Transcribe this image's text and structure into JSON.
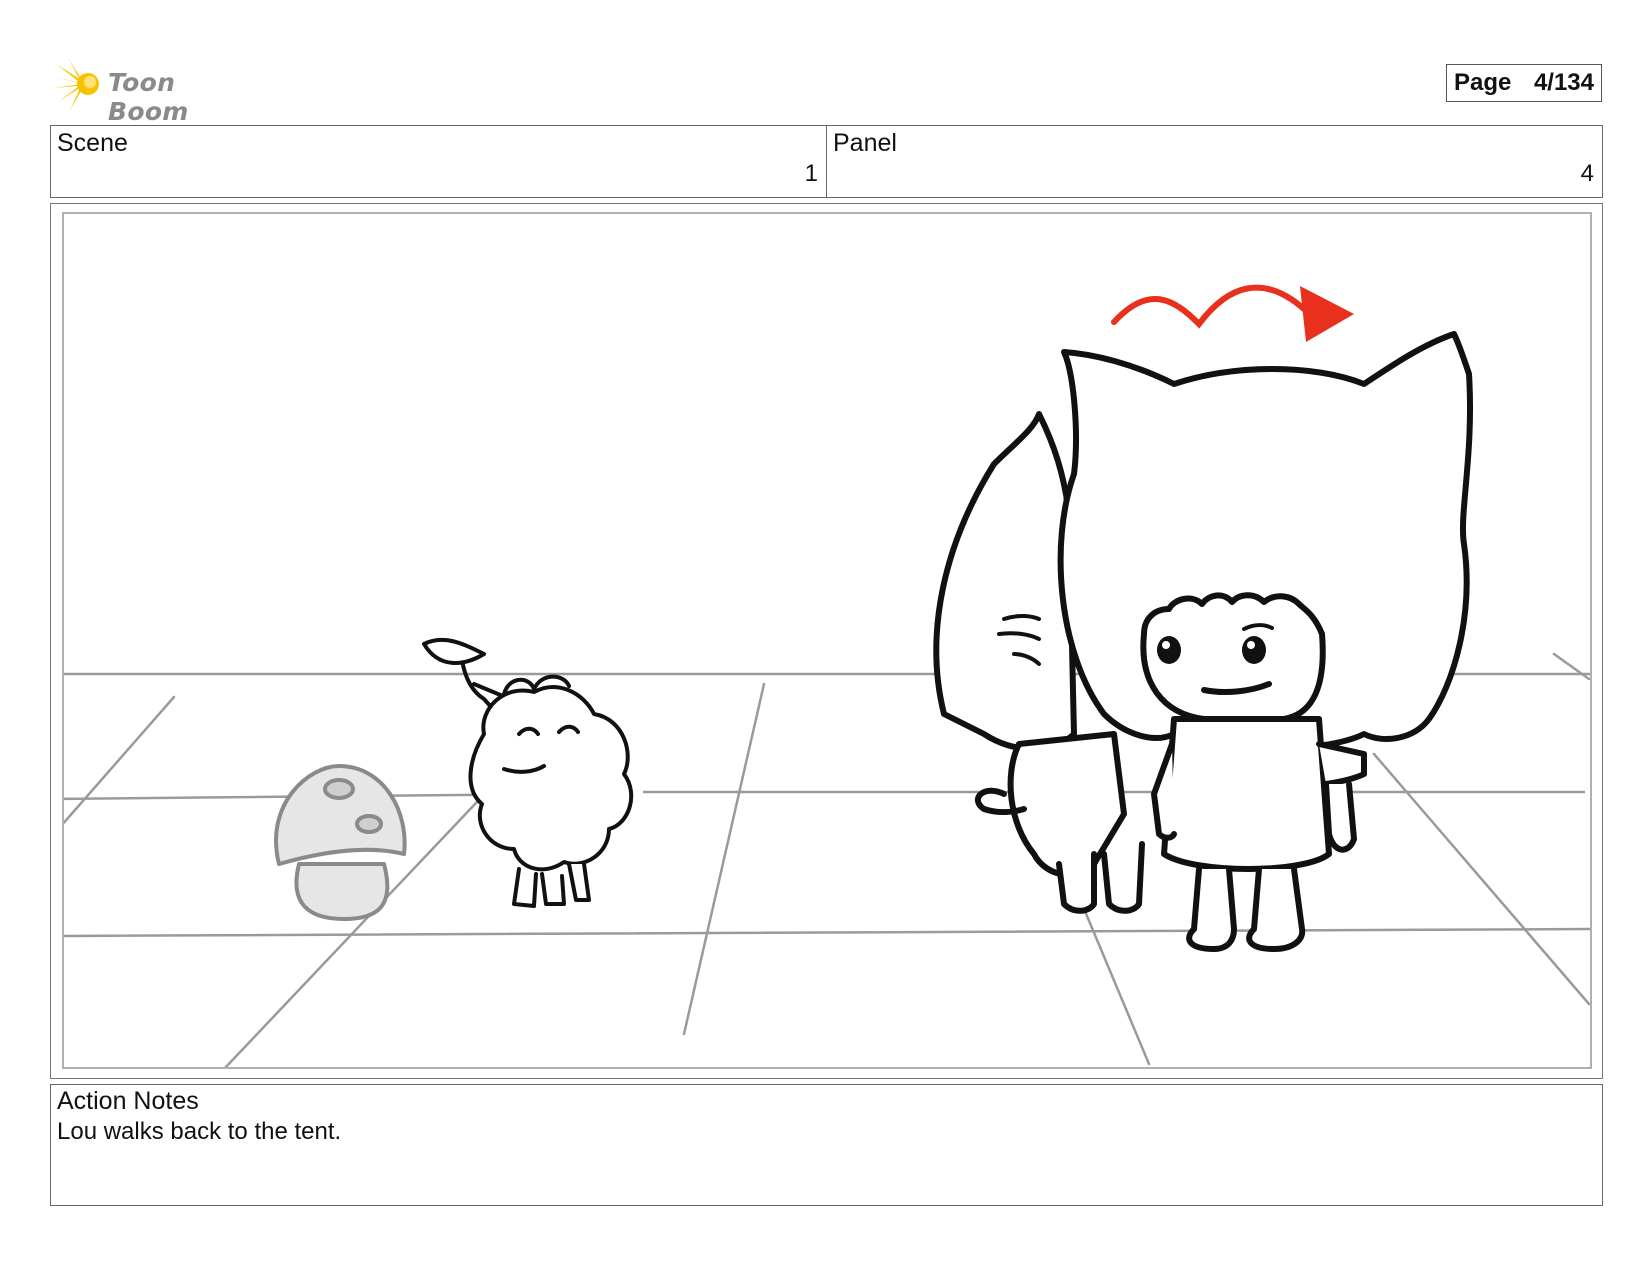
{
  "brand": {
    "name": "Toon Boom",
    "accent_color": "#f5c400"
  },
  "page": {
    "label": "Page",
    "value": "4/134"
  },
  "header": {
    "scene": {
      "label": "Scene",
      "value": "1"
    },
    "panel": {
      "label": "Panel",
      "value": "4"
    }
  },
  "drawing": {
    "subject": "storyboard-sketch",
    "motion_arrow_color": "#e8301c",
    "line_color": "#111111",
    "guide_color": "#9a9a9a"
  },
  "notes": {
    "label": "Action Notes",
    "text": "Lou walks back to the tent."
  }
}
